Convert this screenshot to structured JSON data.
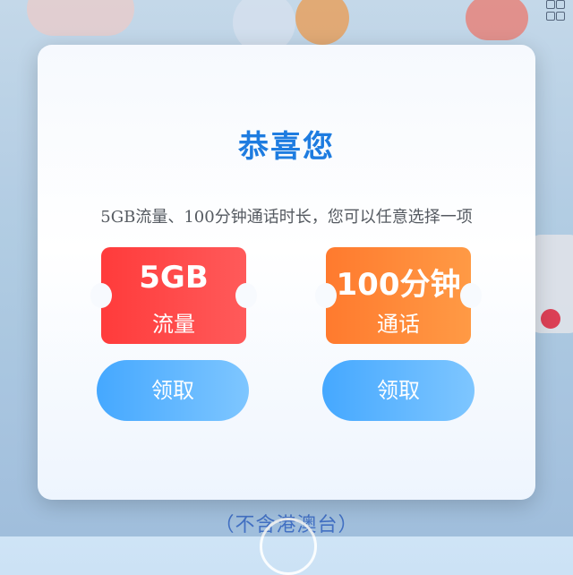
{
  "background": {
    "footer_text": "（不含港澳台）"
  },
  "dialog": {
    "title": "恭喜您",
    "description": "5GB流量、100分钟通话时长，您可以任意选择一项",
    "options": [
      {
        "amount": "5GB",
        "type": "流量",
        "button_label": "领取",
        "color": "#ff4040"
      },
      {
        "amount": "100分钟",
        "type": "通话",
        "button_label": "领取",
        "color": "#ff8a3a"
      }
    ]
  },
  "colors": {
    "title": "#1e7ce0",
    "button": "#4aaaff"
  }
}
